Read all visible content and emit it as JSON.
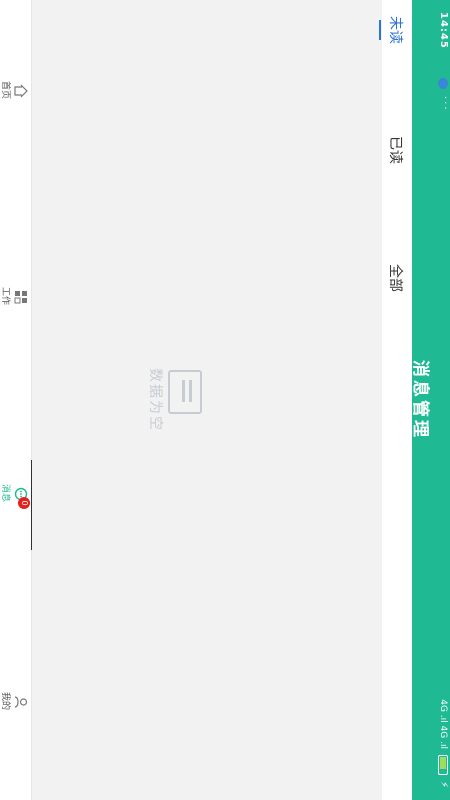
{
  "status_bar": {
    "time": "14:45",
    "dots": "···",
    "signal": "4G .ıl 4G .ıl",
    "battery": "",
    "extra": "⚡"
  },
  "header": {
    "title": "消息管理"
  },
  "tabs": [
    {
      "label": "未读"
    },
    {
      "label": "已读"
    },
    {
      "label": "全部"
    }
  ],
  "empty": {
    "text": "数据为空"
  },
  "bottom_nav": [
    {
      "label": "首页",
      "icon": "home-icon"
    },
    {
      "label": "工作",
      "icon": "grid-icon"
    },
    {
      "label": "消息",
      "icon": "message-icon",
      "badge": "0"
    },
    {
      "label": "我的",
      "icon": "user-icon"
    }
  ],
  "colors": {
    "header": "#1fba93",
    "active_tab": "#2b73d6",
    "badge": "#e6201f",
    "empty": "#c7cbd3"
  }
}
